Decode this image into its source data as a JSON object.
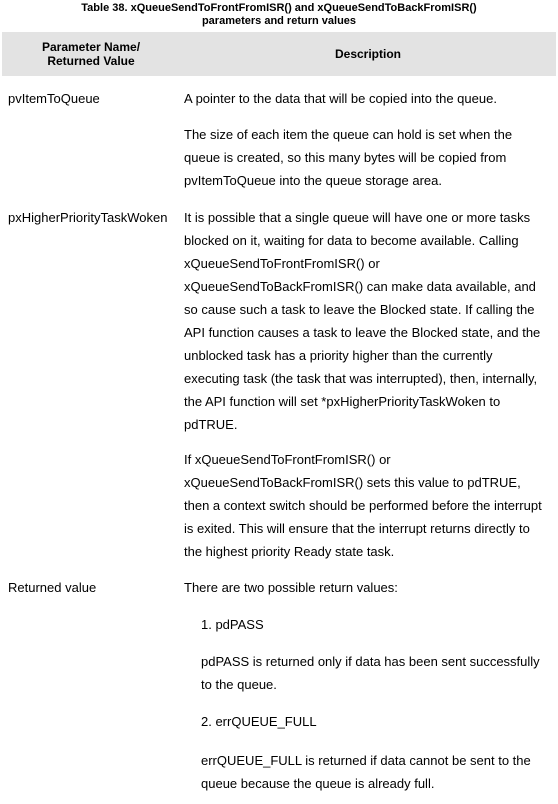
{
  "caption": {
    "line1": "Table 38.  xQueueSendToFrontFromISR() and xQueueSendToBackFromISR()",
    "line2": "parameters and return values"
  },
  "header": {
    "param_line1": "Parameter Name/",
    "param_line2": "Returned Value",
    "description": "Description"
  },
  "rows": [
    {
      "name": "pvItemToQueue",
      "paragraphs": [
        [
          "A pointer to the data that will be copied into the queue."
        ],
        [
          "The size of each item the queue can hold is set when the",
          "queue is created, so this many bytes will be copied from",
          "pvItemToQueue into the queue storage area."
        ]
      ]
    },
    {
      "name": "pxHigherPriorityTaskWoken",
      "paragraphs": [
        [
          "It is possible that a single queue will have one or more tasks",
          "blocked on it, waiting for data to become available.  Calling",
          "xQueueSendToFrontFromISR() or",
          "xQueueSendToBackFromISR() can make data available, and",
          "so cause such a task to leave the Blocked state.  If calling the",
          "API function causes a task to leave the Blocked state, and the",
          "unblocked task has a priority higher than the currently",
          "executing task (the task that was interrupted), then, internally,",
          "the API function will set *pxHigherPriorityTaskWoken to",
          "pdTRUE."
        ],
        [
          "If xQueueSendToFrontFromISR() or",
          "xQueueSendToBackFromISR() sets this value to pdTRUE,",
          "then a context switch should be performed before the interrupt",
          "is exited.  This will ensure that the interrupt returns directly to",
          "the highest priority Ready state task."
        ]
      ]
    },
    {
      "name": "Returned value",
      "paragraphs": [
        [
          "There are two possible return values:"
        ],
        [
          "1.  pdPASS"
        ],
        [
          "pdPASS is returned only if data has been sent successfully",
          "to the queue."
        ],
        [
          "2.  errQUEUE_FULL"
        ],
        [
          "errQUEUE_FULL is returned if data cannot be sent to the",
          "queue because the queue is already full."
        ]
      ]
    }
  ]
}
